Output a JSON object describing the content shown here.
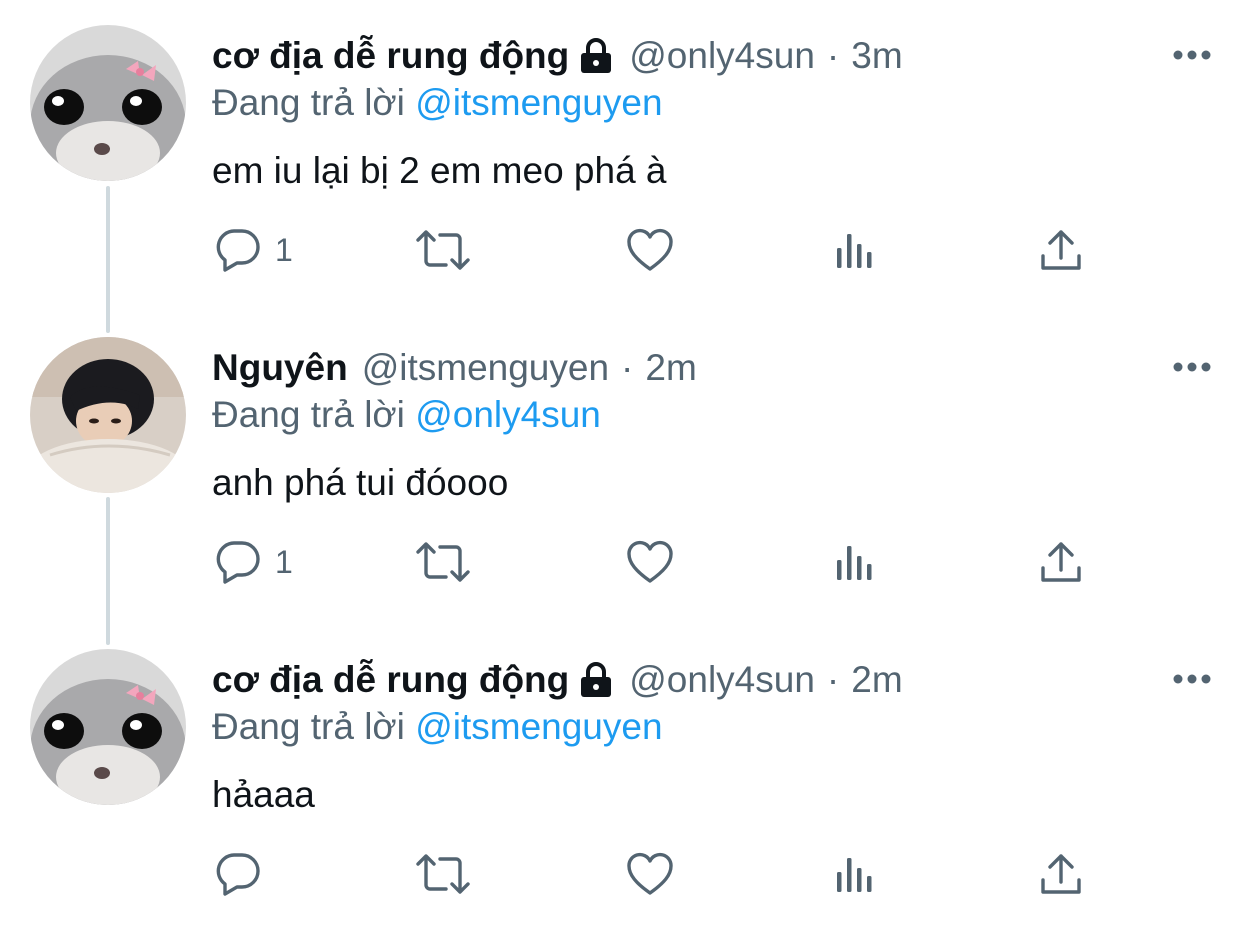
{
  "tweets": [
    {
      "display_name": "cơ địa dễ rung động",
      "handle": "@only4sun",
      "time": "3m",
      "reply_prefix": "Đang trả lời",
      "reply_to": "@itsmenguyen",
      "text": "em iu lại bị 2 em meo phá à",
      "reply_count": "1",
      "avatar": "hamster-avatar"
    },
    {
      "display_name": "Nguyên",
      "handle": "@itsmenguyen",
      "time": "2m",
      "reply_prefix": "Đang trả lời",
      "reply_to": "@only4sun",
      "text": "anh phá tui đóooo",
      "reply_count": "1",
      "avatar": "person-avatar"
    },
    {
      "display_name": "cơ địa dễ rung động",
      "handle": "@only4sun",
      "time": "2m",
      "reply_prefix": "Đang trả lời",
      "reply_to": "@itsmenguyen",
      "text": "hảaaa",
      "reply_count": "",
      "avatar": "hamster-avatar"
    }
  ],
  "separator": "·",
  "icons": [
    "reply-icon",
    "retweet-icon",
    "like-icon",
    "views-icon",
    "share-icon",
    "more-icon",
    "lock-icon"
  ],
  "colors": {
    "text": "#0f1419",
    "muted": "#536471",
    "link": "#1d9bf0",
    "thread_line": "#cfd9de"
  }
}
